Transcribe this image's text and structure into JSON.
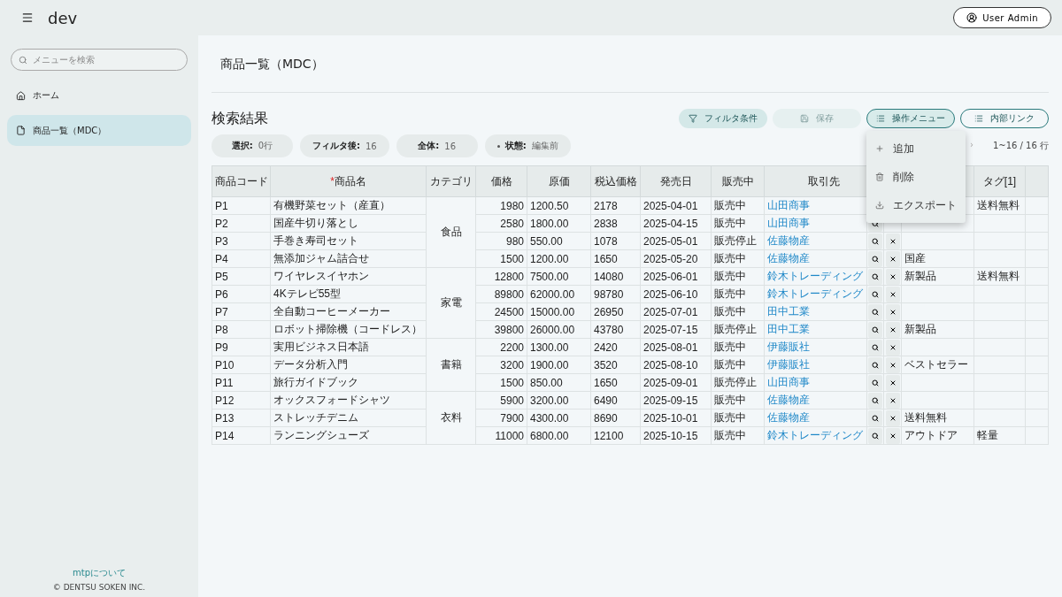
{
  "app": {
    "title": "dev",
    "user_button": "User Admin"
  },
  "sidebar": {
    "search_placeholder": "メニューを検索",
    "items": [
      {
        "label": "ホーム",
        "kind": "home",
        "selected": false
      },
      {
        "label": "商品一覧（MDC）",
        "kind": "page",
        "selected": true
      }
    ],
    "footer_link": "mtpについて",
    "copyright": "© DENTSU SOKEN INC."
  },
  "page": {
    "title": "商品一覧（MDC）",
    "section_title": "検索結果",
    "toolbar": [
      {
        "label": "フィルタ条件",
        "kind": "filter",
        "disabled": false,
        "expanded": false
      },
      {
        "label": "保存",
        "kind": "save",
        "disabled": true,
        "expanded": false
      },
      {
        "label": "操作メニュー",
        "kind": "menu",
        "disabled": false,
        "expanded": true
      },
      {
        "label": "内部リンク",
        "kind": "links",
        "disabled": false,
        "expanded": false
      }
    ],
    "menu_items": [
      {
        "label": "追加",
        "kind": "add"
      },
      {
        "label": "削除",
        "kind": "delete"
      },
      {
        "label": "エクスポート",
        "kind": "export"
      }
    ],
    "chips": [
      {
        "label": "選択:",
        "value": "0行",
        "dirty": false
      },
      {
        "label": "フィルタ後:",
        "value": "16",
        "dirty": false
      },
      {
        "label": "全体:",
        "value": "16",
        "dirty": false
      },
      {
        "label": "状態:",
        "value": "編集前",
        "dirty": true
      }
    ],
    "pagination": {
      "next": "›",
      "range": "1~16 / 16 行"
    }
  },
  "table": {
    "columns": [
      {
        "label": "商品コード"
      },
      {
        "label": "商品名",
        "required_mark": "*"
      },
      {
        "label": "カテゴリ"
      },
      {
        "label": "価格"
      },
      {
        "label": "原価"
      },
      {
        "label": "税込価格"
      },
      {
        "label": "発売日"
      },
      {
        "label": "販売中"
      },
      {
        "label": "取引先"
      },
      {
        "label": "タグ[1]"
      }
    ],
    "groups": [
      {
        "category": "食品",
        "rows": [
          {
            "code": "P1",
            "name": "有機野菜セット（産直）",
            "price": "1980",
            "cost": "1200.50",
            "taxed": "2178",
            "date": "2025-04-01",
            "status": "販売中",
            "partner": "山田商事",
            "tag_1": "送料無料"
          },
          {
            "code": "P2",
            "name": "国産牛切り落とし",
            "price": "2580",
            "cost": "1800.00",
            "taxed": "2838",
            "date": "2025-04-15",
            "status": "販売中",
            "partner": "山田商事"
          },
          {
            "code": "P3",
            "name": "手巻き寿司セット",
            "price": "980",
            "cost": "550.00",
            "taxed": "1078",
            "date": "2025-05-01",
            "status": "販売停止",
            "partner": "佐藤物産"
          },
          {
            "code": "P4",
            "name": "無添加ジャム詰合せ",
            "price": "1500",
            "cost": "1200.00",
            "taxed": "1650",
            "date": "2025-05-20",
            "status": "販売中",
            "partner": "佐藤物産",
            "tag_0": "国産"
          }
        ]
      },
      {
        "category": "家電",
        "rows": [
          {
            "code": "P5",
            "name": "ワイヤレスイヤホン",
            "price": "12800",
            "cost": "7500.00",
            "taxed": "14080",
            "date": "2025-06-01",
            "status": "販売中",
            "partner": "鈴木トレーディング",
            "tag_0": "新製品",
            "tag_1": "送料無料"
          },
          {
            "code": "P6",
            "name": "4Kテレビ55型",
            "price": "89800",
            "cost": "62000.00",
            "taxed": "98780",
            "date": "2025-06-10",
            "status": "販売中",
            "partner": "鈴木トレーディング"
          },
          {
            "code": "P7",
            "name": "全自動コーヒーメーカー",
            "price": "24500",
            "cost": "15000.00",
            "taxed": "26950",
            "date": "2025-07-01",
            "status": "販売中",
            "partner": "田中工業"
          },
          {
            "code": "P8",
            "name": "ロボット掃除機（コードレス）",
            "price": "39800",
            "cost": "26000.00",
            "taxed": "43780",
            "date": "2025-07-15",
            "status": "販売停止",
            "partner": "田中工業",
            "tag_0": "新製品"
          }
        ]
      },
      {
        "category": "書籍",
        "rows": [
          {
            "code": "P9",
            "name": "実用ビジネス日本語",
            "price": "2200",
            "cost": "1300.00",
            "taxed": "2420",
            "date": "2025-08-01",
            "status": "販売中",
            "partner": "伊藤販社"
          },
          {
            "code": "P10",
            "name": "データ分析入門",
            "price": "3200",
            "cost": "1900.00",
            "taxed": "3520",
            "date": "2025-08-10",
            "status": "販売中",
            "partner": "伊藤販社",
            "tag_0": "ベストセラー"
          },
          {
            "code": "P11",
            "name": "旅行ガイドブック",
            "price": "1500",
            "cost": "850.00",
            "taxed": "1650",
            "date": "2025-09-01",
            "status": "販売停止",
            "partner": "山田商事"
          }
        ]
      },
      {
        "category": "衣料",
        "rows": [
          {
            "code": "P12",
            "name": "オックスフォードシャツ",
            "price": "5900",
            "cost": "3200.00",
            "taxed": "6490",
            "date": "2025-09-15",
            "status": "販売中",
            "partner": "佐藤物産"
          },
          {
            "code": "P13",
            "name": "ストレッチデニム",
            "price": "7900",
            "cost": "4300.00",
            "taxed": "8690",
            "date": "2025-10-01",
            "status": "販売中",
            "partner": "佐藤物産",
            "tag_0": "送料無料"
          },
          {
            "code": "P14",
            "name": "ランニングシューズ",
            "price": "11000",
            "cost": "6800.00",
            "taxed": "12100",
            "date": "2025-10-15",
            "status": "販売中",
            "partner": "鈴木トレーディング",
            "tag_0": "アウトドア",
            "tag_1": "軽量"
          }
        ]
      }
    ]
  }
}
